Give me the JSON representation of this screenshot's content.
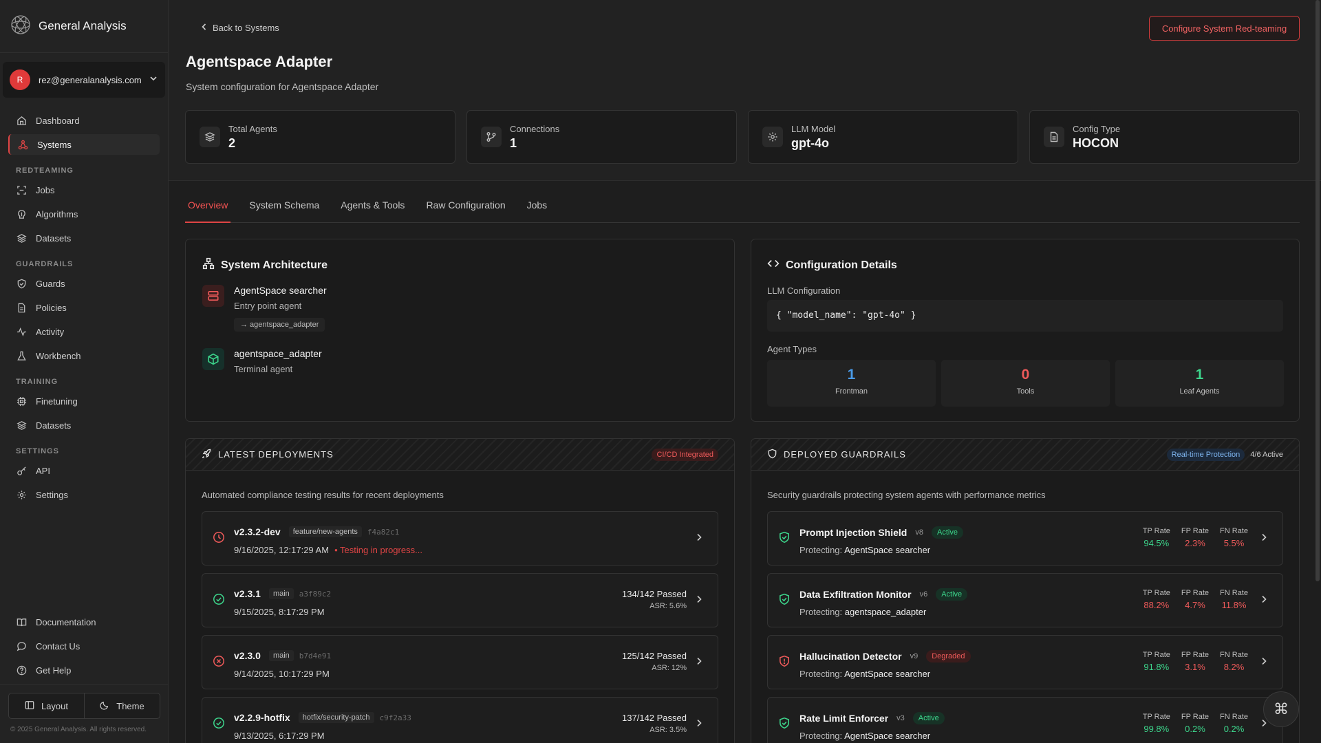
{
  "brand": {
    "name": "General Analysis"
  },
  "account": {
    "initial": "R",
    "email": "rez@generalanalysis.com"
  },
  "nav": {
    "dashboard": "Dashboard",
    "systems": "Systems",
    "redteaming_label": "REDTEAMING",
    "jobs": "Jobs",
    "algorithms": "Algorithms",
    "datasets": "Datasets",
    "guardrails_label": "GUARDRAILS",
    "guards": "Guards",
    "policies": "Policies",
    "activity": "Activity",
    "workbench": "Workbench",
    "training_label": "TRAINING",
    "finetuning": "Finetuning",
    "training_datasets": "Datasets",
    "settings_label": "SETTINGS",
    "api": "API",
    "settings": "Settings",
    "documentation": "Documentation",
    "contact": "Contact Us",
    "help": "Get Help",
    "layout": "Layout",
    "theme": "Theme",
    "copyright": "© 2025 General Analysis. All rights reserved."
  },
  "header": {
    "back": "Back to Systems",
    "configure": "Configure System Red-teaming",
    "title": "Agentspace Adapter",
    "subtitle": "System configuration for Agentspace Adapter"
  },
  "stats": [
    {
      "label": "Total Agents",
      "value": "2"
    },
    {
      "label": "Connections",
      "value": "1"
    },
    {
      "label": "LLM Model",
      "value": "gpt-4o"
    },
    {
      "label": "Config Type",
      "value": "HOCON"
    }
  ],
  "tabs": [
    "Overview",
    "System Schema",
    "Agents & Tools",
    "Raw Configuration",
    "Jobs"
  ],
  "architecture": {
    "title": "System Architecture",
    "agents": [
      {
        "name": "AgentSpace searcher",
        "role": "Entry point agent",
        "link": "→ agentspace_adapter"
      },
      {
        "name": "agentspace_adapter",
        "role": "Terminal agent"
      }
    ]
  },
  "config": {
    "title": "Configuration Details",
    "llm_label": "LLM Configuration",
    "llm_code": "{ \"model_name\": \"gpt-4o\" }",
    "types_label": "Agent Types",
    "types": [
      {
        "value": "1",
        "label": "Frontman",
        "color": "#4a9be8"
      },
      {
        "value": "0",
        "label": "Tools",
        "color": "#ef5a5a"
      },
      {
        "value": "1",
        "label": "Leaf Agents",
        "color": "#3dd68c"
      }
    ]
  },
  "deployments": {
    "title": "LATEST DEPLOYMENTS",
    "badge": "CI/CD Integrated",
    "description": "Automated compliance testing results for recent deployments",
    "items": [
      {
        "version": "v2.3.2-dev",
        "branch": "feature/new-agents",
        "hash": "f4a82c1",
        "date": "9/16/2025, 12:17:29 AM",
        "progress": "• Testing in progress...",
        "status": "running"
      },
      {
        "version": "v2.3.1",
        "branch": "main",
        "hash": "a3f89c2",
        "date": "9/15/2025, 8:17:29 PM",
        "passed": "134/142 Passed",
        "asr": "ASR: 5.6%",
        "status": "pass"
      },
      {
        "version": "v2.3.0",
        "branch": "main",
        "hash": "b7d4e91",
        "date": "9/14/2025, 10:17:29 PM",
        "passed": "125/142 Passed",
        "asr": "ASR: 12%",
        "status": "fail"
      },
      {
        "version": "v2.2.9-hotfix",
        "branch": "hotfix/security-patch",
        "hash": "c9f2a33",
        "date": "9/13/2025, 6:17:29 PM",
        "passed": "137/142 Passed",
        "asr": "ASR: 3.5%",
        "status": "pass"
      }
    ]
  },
  "guardrails": {
    "title": "DEPLOYED GUARDRAILS",
    "badge": "Real-time Protection",
    "active_count": "4/6 Active",
    "description": "Security guardrails protecting system agents with performance metrics",
    "protecting_label": "Protecting:",
    "metric_labels": [
      "TP Rate",
      "FP Rate",
      "FN Rate"
    ],
    "items": [
      {
        "name": "Prompt Injection Shield",
        "version": "v8",
        "status": "Active",
        "target": "AgentSpace searcher",
        "tp": "94.5%",
        "fp": "2.3%",
        "fn": "5.5%",
        "tp_color": "green",
        "fp_color": "red",
        "fn_color": "red"
      },
      {
        "name": "Data Exfiltration Monitor",
        "version": "v6",
        "status": "Active",
        "target": "agentspace_adapter",
        "tp": "88.2%",
        "fp": "4.7%",
        "fn": "11.8%",
        "tp_color": "red",
        "fp_color": "red",
        "fn_color": "red"
      },
      {
        "name": "Hallucination Detector",
        "version": "v9",
        "status": "Degraded",
        "target": "AgentSpace searcher",
        "tp": "91.8%",
        "fp": "3.1%",
        "fn": "8.2%",
        "tp_color": "green",
        "fp_color": "red",
        "fn_color": "red"
      },
      {
        "name": "Rate Limit Enforcer",
        "version": "v3",
        "status": "Active",
        "target": "AgentSpace searcher",
        "tp": "99.8%",
        "fp": "0.2%",
        "fn": "0.2%",
        "tp_color": "green",
        "fp_color": "green",
        "fn_color": "green"
      }
    ]
  },
  "colors": {
    "accent": "#e04545",
    "success": "#3dd68c",
    "info": "#4a9be8"
  }
}
